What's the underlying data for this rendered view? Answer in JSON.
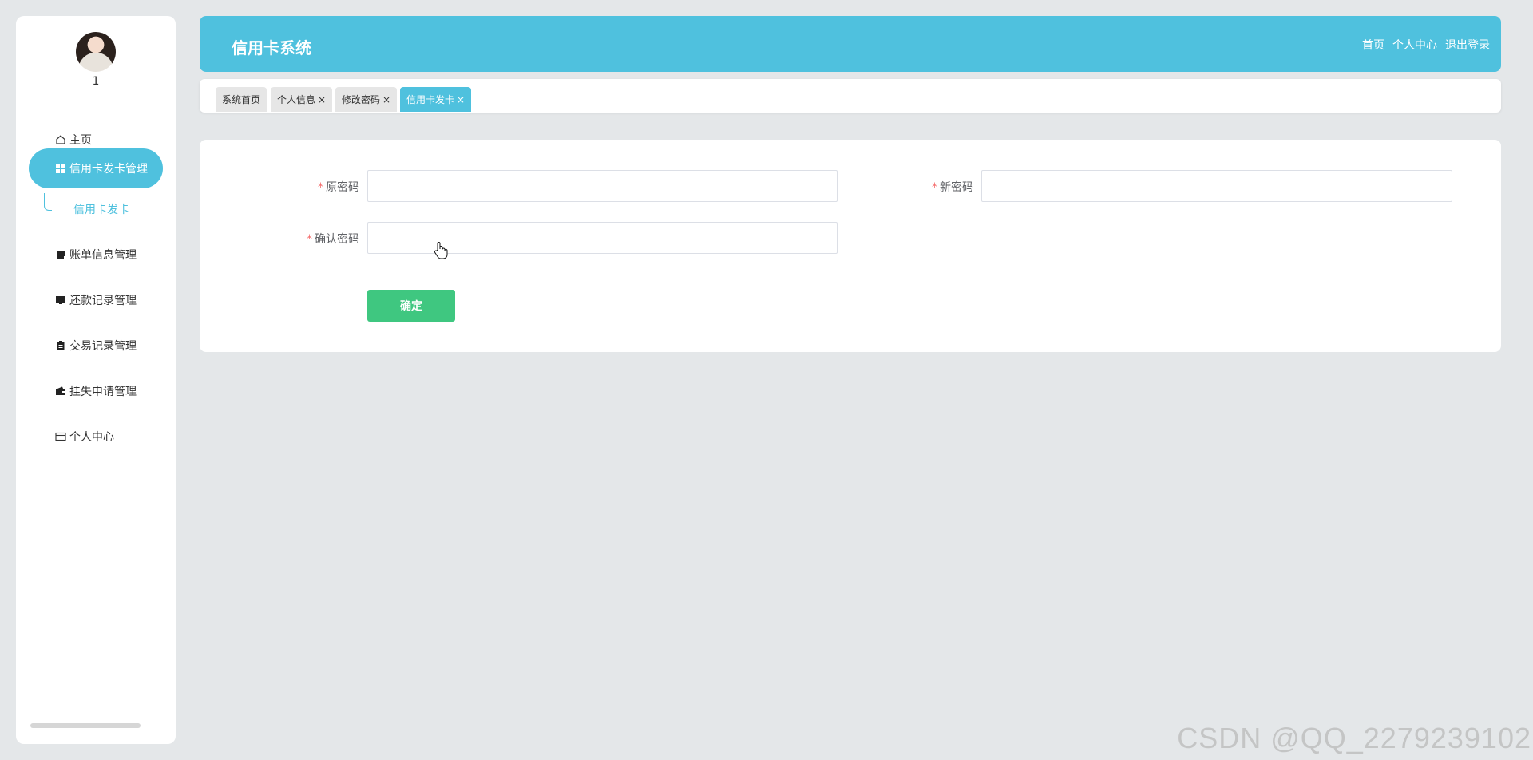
{
  "sidebar": {
    "username": "1",
    "items": [
      {
        "label": "主页",
        "icon": "home-icon"
      },
      {
        "label": "信用卡发卡管理",
        "icon": "grid-icon",
        "active": true
      },
      {
        "label": "账单信息管理",
        "icon": "printer-icon"
      },
      {
        "label": "还款记录管理",
        "icon": "monitor-icon"
      },
      {
        "label": "交易记录管理",
        "icon": "clipboard-icon"
      },
      {
        "label": "挂失申请管理",
        "icon": "wallet-icon"
      },
      {
        "label": "个人中心",
        "icon": "card-icon"
      }
    ],
    "submenu_item": "信用卡发卡"
  },
  "header": {
    "title": "信用卡系统",
    "links": [
      "首页",
      "个人中心",
      "退出登录"
    ]
  },
  "tabs": [
    {
      "label": "系统首页",
      "closable": false
    },
    {
      "label": "个人信息",
      "closable": true
    },
    {
      "label": "修改密码",
      "closable": true
    },
    {
      "label": "信用卡发卡",
      "closable": true,
      "active": true
    }
  ],
  "form": {
    "old_password_label": "原密码",
    "new_password_label": "新密码",
    "confirm_password_label": "确认密码",
    "old_password_value": "",
    "new_password_value": "",
    "confirm_password_value": "",
    "submit_label": "确定"
  },
  "watermark": "CSDN @QQ_2279239102",
  "colors": {
    "accent": "#4fc1de",
    "button": "#3fc780",
    "required": "#f56c6c",
    "background": "#e4e7e9"
  }
}
